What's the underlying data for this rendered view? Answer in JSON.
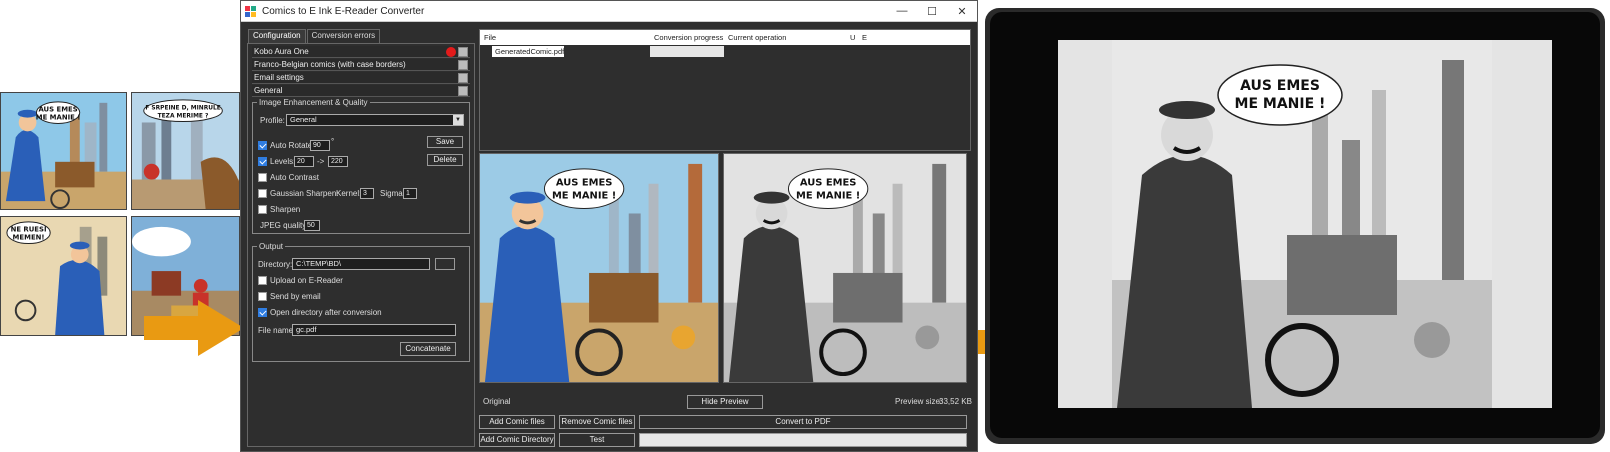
{
  "window": {
    "title": "Comics to E Ink E-Reader Converter",
    "minimize": "—",
    "maximize": "☐",
    "close": "✕"
  },
  "tabs": [
    "Configuration",
    "Conversion errors"
  ],
  "profiles": [
    {
      "label": "Kobo Aura One"
    },
    {
      "label": "Franco-Belgian comics (with case borders)"
    },
    {
      "label": "Email settings"
    },
    {
      "label": "General"
    }
  ],
  "image_enhancement": {
    "legend": "Image Enhancement & Quality",
    "profile_label": "Profile:",
    "profile_value": "General",
    "save_label": "Save",
    "delete_label": "Delete",
    "auto_rotate_label": "Auto Rotate:",
    "auto_rotate_value": "90",
    "auto_rotate_unit": "°",
    "levels_label": "Levels:",
    "levels_min": "20",
    "levels_arrow": "->",
    "levels_max": "220",
    "auto_contrast_label": "Auto Contrast",
    "gaussian_label": "Gaussian Sharpen:",
    "kernel_label": "Kernel:",
    "kernel_value": "3",
    "sigma_label": "Sigma:",
    "sigma_value": "1",
    "sharpen_label": "Sharpen",
    "jpeg_label": "JPEG quality:",
    "jpeg_value": "50"
  },
  "output": {
    "legend": "Output",
    "directory_label": "Directory:",
    "directory_value": "C:\\TEMP\\BD\\",
    "upload_label": "Upload on E-Reader",
    "email_label": "Send by email",
    "open_dir_label": "Open directory after conversion",
    "filename_label": "File name:",
    "filename_value": "gc.pdf",
    "concatenate_label": "Concatenate"
  },
  "file_list": {
    "headers": [
      "File",
      "Conversion progress",
      "Current operation",
      "U",
      "E"
    ],
    "rows": [
      {
        "file": "GeneratedComic.pdf"
      }
    ]
  },
  "preview": {
    "original_label": "Original",
    "hide_preview_label": "Hide Preview",
    "size_label": "Preview size:",
    "size_value": "33,52 KB"
  },
  "actions": {
    "add_files": "Add Comic files",
    "remove_files": "Remove Comic files",
    "convert": "Convert to PDF",
    "add_directory": "Add Comic Directory",
    "test": "Test"
  },
  "comic": {
    "bubble_line1": "AUS EMES",
    "bubble_line2": "ME MANIE !",
    "panel2_line1": "F SRPEINE D, MINRULE",
    "panel2_line2": "TEZA MERIME ?",
    "panel3_line1": "NE RUESI",
    "panel3_line2": "MEMEN!"
  },
  "colors": {
    "accent_arrow": "#e99a12",
    "window_bg": "#2e2e2e",
    "checkbox": "#2f7de1",
    "record_dot": "#e31b1b"
  }
}
